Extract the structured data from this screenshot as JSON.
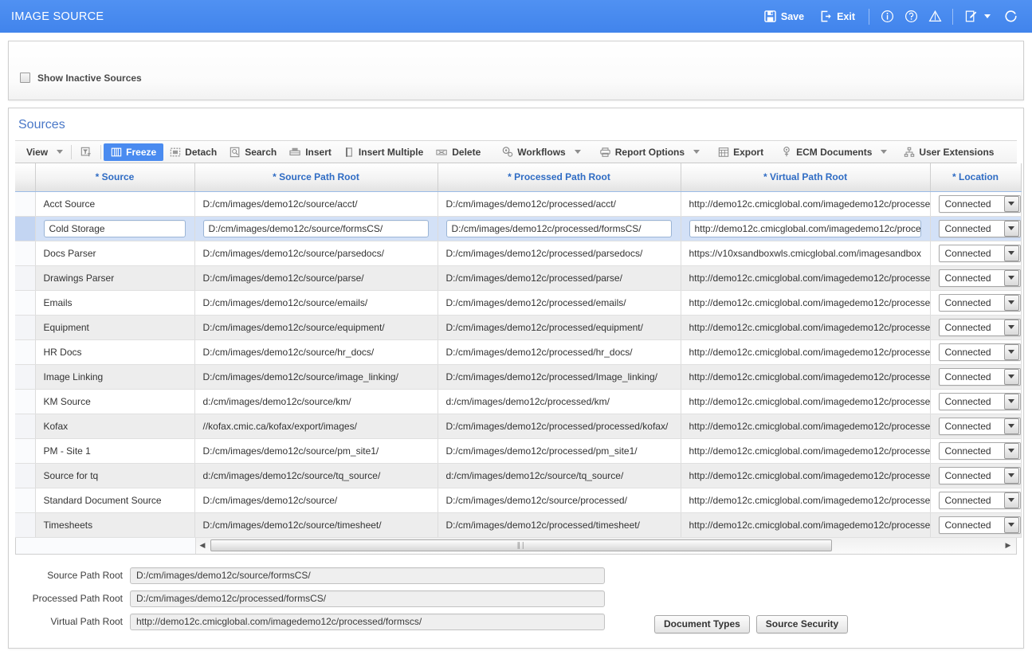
{
  "header": {
    "title": "IMAGE SOURCE",
    "save_label": "Save",
    "exit_label": "Exit",
    "accent_color": "#4a8bf0",
    "icons": {
      "save": "save-icon",
      "exit": "exit-icon",
      "info": "info-icon",
      "help": "help-icon",
      "warning": "warning-icon",
      "edit": "edit-note-icon",
      "refresh": "refresh-icon"
    }
  },
  "filter": {
    "show_inactive_label": "Show Inactive Sources",
    "show_inactive_checked": false
  },
  "sources": {
    "title": "Sources",
    "toolbar": [
      {
        "label": "View",
        "icon": "view-icon",
        "caret": true,
        "active": false
      },
      {
        "label": "",
        "icon": "filter-icon",
        "caret": false,
        "active": false
      },
      {
        "label": "Freeze",
        "icon": "freeze-icon",
        "caret": false,
        "active": true
      },
      {
        "label": "Detach",
        "icon": "detach-icon",
        "caret": false,
        "active": false
      },
      {
        "label": "Search",
        "icon": "search-icon",
        "caret": false,
        "active": false
      },
      {
        "label": "Insert",
        "icon": "insert-icon",
        "caret": false,
        "active": false
      },
      {
        "label": "Insert Multiple",
        "icon": "insert-multiple-icon",
        "caret": false,
        "active": false
      },
      {
        "label": "Delete",
        "icon": "delete-icon",
        "caret": false,
        "active": false
      },
      {
        "label": "Workflows",
        "icon": "workflows-icon",
        "caret": true,
        "active": false
      },
      {
        "label": "Report Options",
        "icon": "report-options-icon",
        "caret": true,
        "active": false
      },
      {
        "label": "Export",
        "icon": "export-icon",
        "caret": false,
        "active": false
      },
      {
        "label": "ECM Documents",
        "icon": "ecm-documents-icon",
        "caret": true,
        "active": false
      },
      {
        "label": "User Extensions",
        "icon": "user-extensions-icon",
        "caret": false,
        "active": false
      }
    ],
    "columns": [
      "* Source",
      "* Source Path Root",
      "* Processed Path Root",
      "* Virtual Path Root",
      "* Location"
    ],
    "rows": [
      {
        "source": "Acct Source",
        "source_path_root": "D:/cm/images/demo12c/source/acct/",
        "processed_path_root": "D:/cm/images/demo12c/processed/acct/",
        "virtual_path_root": "http://demo12c.cmicglobal.com/imagedemo12c/processe",
        "location": "Connected",
        "selected": false,
        "alt": false
      },
      {
        "source": "Cold Storage",
        "source_path_root": "D:/cm/images/demo12c/source/formsCS/",
        "processed_path_root": "D:/cm/images/demo12c/processed/formsCS/",
        "virtual_path_root": "http://demo12c.cmicglobal.com/imagedemo12c/processe",
        "location": "Connected",
        "selected": true,
        "alt": false
      },
      {
        "source": "Docs Parser",
        "source_path_root": "D:/cm/images/demo12c/source/parsedocs/",
        "processed_path_root": "D:/cm/images/demo12c/processed/parsedocs/",
        "virtual_path_root": "https://v10xsandboxwls.cmicglobal.com/imagesandbox",
        "location": "Connected",
        "selected": false,
        "alt": false
      },
      {
        "source": "Drawings Parser",
        "source_path_root": "D:/cm/images/demo12c/source/parse/",
        "processed_path_root": "D:/cm/images/demo12c/processed/parse/",
        "virtual_path_root": "http://demo12c.cmicglobal.com/imagedemo12c/processe",
        "location": "Connected",
        "selected": false,
        "alt": true
      },
      {
        "source": "Emails",
        "source_path_root": "D:/cm/images/demo12c/source/emails/",
        "processed_path_root": "D:/cm/images/demo12c/processed/emails/",
        "virtual_path_root": "http://demo12c.cmicglobal.com/imagedemo12c/processe",
        "location": "Connected",
        "selected": false,
        "alt": false
      },
      {
        "source": "Equipment",
        "source_path_root": "D:/cm/images/demo12c/source/equipment/",
        "processed_path_root": "D:/cm/images/demo12c/processed/equipment/",
        "virtual_path_root": "http://demo12c.cmicglobal.com/imagedemo12c/processe",
        "location": "Connected",
        "selected": false,
        "alt": true
      },
      {
        "source": "HR Docs",
        "source_path_root": "D:/cm/images/demo12c/source/hr_docs/",
        "processed_path_root": "D:/cm/images/demo12c/processed/hr_docs/",
        "virtual_path_root": "http://demo12c.cmicglobal.com/imagedemo12c/processe",
        "location": "Connected",
        "selected": false,
        "alt": false
      },
      {
        "source": "Image Linking",
        "source_path_root": "D:/cm/images/demo12c/source/image_linking/",
        "processed_path_root": "D:/cm/images/demo12c/processed/Image_linking/",
        "virtual_path_root": "http://demo12c.cmicglobal.com/imagedemo12c/processe",
        "location": "Connected",
        "selected": false,
        "alt": true
      },
      {
        "source": "KM Source",
        "source_path_root": "d:/cm/images/demo12c/source/km/",
        "processed_path_root": "d:/cm/images/demo12c/processed/km/",
        "virtual_path_root": "http://demo12c.cmicglobal.com/imagedemo12c/processe",
        "location": "Connected",
        "selected": false,
        "alt": false
      },
      {
        "source": "Kofax",
        "source_path_root": "//kofax.cmic.ca/kofax/export/images/",
        "processed_path_root": "D:/cm/images/demo12c/processed/processed/kofax/",
        "virtual_path_root": "http://demo12c.cmicglobal.com/imagedemo12c/processe",
        "location": "Connected",
        "selected": false,
        "alt": true
      },
      {
        "source": "PM - Site 1",
        "source_path_root": "D:/cm/images/demo12c/source/pm_site1/",
        "processed_path_root": "D:/cm/images/demo12c/processed/pm_site1/",
        "virtual_path_root": "http://demo12c.cmicglobal.com/imagedemo12c/processe",
        "location": "Connected",
        "selected": false,
        "alt": false
      },
      {
        "source": "Source for tq",
        "source_path_root": "d:/cm/images/demo12c/source/tq_source/",
        "processed_path_root": "d:/cm/images/demo12c/source/tq_source/",
        "virtual_path_root": "http://demo12c.cmicglobal.com/imagedemo12c/processe",
        "location": "Connected",
        "selected": false,
        "alt": true
      },
      {
        "source": "Standard Document Source",
        "source_path_root": "D:/cm/images/demo12c/source/",
        "processed_path_root": "D:/cm/images/demo12c/source/processed/",
        "virtual_path_root": "http://demo12c.cmicglobal.com/imagedemo12c/processe",
        "location": "Connected",
        "selected": false,
        "alt": false
      },
      {
        "source": "Timesheets",
        "source_path_root": "D:/cm/images/demo12c/source/timesheet/",
        "processed_path_root": "D:/cm/images/demo12c/processed/timesheet/",
        "virtual_path_root": "http://demo12c.cmicglobal.com/imagedemo12c/processe",
        "location": "Connected",
        "selected": false,
        "alt": true
      }
    ]
  },
  "detail": {
    "source_path_root_label": "Source Path Root",
    "source_path_root_value": "D:/cm/images/demo12c/source/formsCS/",
    "processed_path_root_label": "Processed Path Root",
    "processed_path_root_value": "D:/cm/images/demo12c/processed/formsCS/",
    "virtual_path_root_label": "Virtual Path Root",
    "virtual_path_root_value": "http://demo12c.cmicglobal.com/imagedemo12c/processed/formscs/",
    "document_types_button": "Document Types",
    "source_security_button": "Source Security"
  }
}
